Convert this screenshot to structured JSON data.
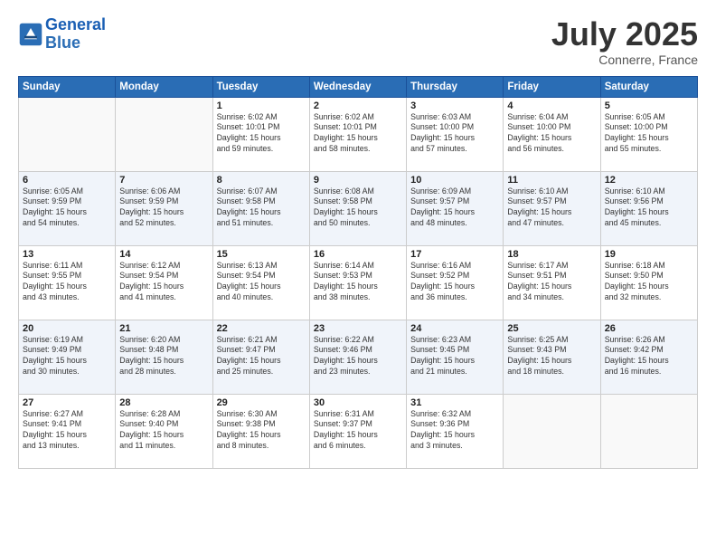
{
  "header": {
    "logo_line1": "General",
    "logo_line2": "Blue",
    "month": "July 2025",
    "location": "Connerre, France"
  },
  "days_of_week": [
    "Sunday",
    "Monday",
    "Tuesday",
    "Wednesday",
    "Thursday",
    "Friday",
    "Saturday"
  ],
  "weeks": [
    [
      {
        "day": "",
        "info": ""
      },
      {
        "day": "",
        "info": ""
      },
      {
        "day": "1",
        "info": "Sunrise: 6:02 AM\nSunset: 10:01 PM\nDaylight: 15 hours\nand 59 minutes."
      },
      {
        "day": "2",
        "info": "Sunrise: 6:02 AM\nSunset: 10:01 PM\nDaylight: 15 hours\nand 58 minutes."
      },
      {
        "day": "3",
        "info": "Sunrise: 6:03 AM\nSunset: 10:00 PM\nDaylight: 15 hours\nand 57 minutes."
      },
      {
        "day": "4",
        "info": "Sunrise: 6:04 AM\nSunset: 10:00 PM\nDaylight: 15 hours\nand 56 minutes."
      },
      {
        "day": "5",
        "info": "Sunrise: 6:05 AM\nSunset: 10:00 PM\nDaylight: 15 hours\nand 55 minutes."
      }
    ],
    [
      {
        "day": "6",
        "info": "Sunrise: 6:05 AM\nSunset: 9:59 PM\nDaylight: 15 hours\nand 54 minutes."
      },
      {
        "day": "7",
        "info": "Sunrise: 6:06 AM\nSunset: 9:59 PM\nDaylight: 15 hours\nand 52 minutes."
      },
      {
        "day": "8",
        "info": "Sunrise: 6:07 AM\nSunset: 9:58 PM\nDaylight: 15 hours\nand 51 minutes."
      },
      {
        "day": "9",
        "info": "Sunrise: 6:08 AM\nSunset: 9:58 PM\nDaylight: 15 hours\nand 50 minutes."
      },
      {
        "day": "10",
        "info": "Sunrise: 6:09 AM\nSunset: 9:57 PM\nDaylight: 15 hours\nand 48 minutes."
      },
      {
        "day": "11",
        "info": "Sunrise: 6:10 AM\nSunset: 9:57 PM\nDaylight: 15 hours\nand 47 minutes."
      },
      {
        "day": "12",
        "info": "Sunrise: 6:10 AM\nSunset: 9:56 PM\nDaylight: 15 hours\nand 45 minutes."
      }
    ],
    [
      {
        "day": "13",
        "info": "Sunrise: 6:11 AM\nSunset: 9:55 PM\nDaylight: 15 hours\nand 43 minutes."
      },
      {
        "day": "14",
        "info": "Sunrise: 6:12 AM\nSunset: 9:54 PM\nDaylight: 15 hours\nand 41 minutes."
      },
      {
        "day": "15",
        "info": "Sunrise: 6:13 AM\nSunset: 9:54 PM\nDaylight: 15 hours\nand 40 minutes."
      },
      {
        "day": "16",
        "info": "Sunrise: 6:14 AM\nSunset: 9:53 PM\nDaylight: 15 hours\nand 38 minutes."
      },
      {
        "day": "17",
        "info": "Sunrise: 6:16 AM\nSunset: 9:52 PM\nDaylight: 15 hours\nand 36 minutes."
      },
      {
        "day": "18",
        "info": "Sunrise: 6:17 AM\nSunset: 9:51 PM\nDaylight: 15 hours\nand 34 minutes."
      },
      {
        "day": "19",
        "info": "Sunrise: 6:18 AM\nSunset: 9:50 PM\nDaylight: 15 hours\nand 32 minutes."
      }
    ],
    [
      {
        "day": "20",
        "info": "Sunrise: 6:19 AM\nSunset: 9:49 PM\nDaylight: 15 hours\nand 30 minutes."
      },
      {
        "day": "21",
        "info": "Sunrise: 6:20 AM\nSunset: 9:48 PM\nDaylight: 15 hours\nand 28 minutes."
      },
      {
        "day": "22",
        "info": "Sunrise: 6:21 AM\nSunset: 9:47 PM\nDaylight: 15 hours\nand 25 minutes."
      },
      {
        "day": "23",
        "info": "Sunrise: 6:22 AM\nSunset: 9:46 PM\nDaylight: 15 hours\nand 23 minutes."
      },
      {
        "day": "24",
        "info": "Sunrise: 6:23 AM\nSunset: 9:45 PM\nDaylight: 15 hours\nand 21 minutes."
      },
      {
        "day": "25",
        "info": "Sunrise: 6:25 AM\nSunset: 9:43 PM\nDaylight: 15 hours\nand 18 minutes."
      },
      {
        "day": "26",
        "info": "Sunrise: 6:26 AM\nSunset: 9:42 PM\nDaylight: 15 hours\nand 16 minutes."
      }
    ],
    [
      {
        "day": "27",
        "info": "Sunrise: 6:27 AM\nSunset: 9:41 PM\nDaylight: 15 hours\nand 13 minutes."
      },
      {
        "day": "28",
        "info": "Sunrise: 6:28 AM\nSunset: 9:40 PM\nDaylight: 15 hours\nand 11 minutes."
      },
      {
        "day": "29",
        "info": "Sunrise: 6:30 AM\nSunset: 9:38 PM\nDaylight: 15 hours\nand 8 minutes."
      },
      {
        "day": "30",
        "info": "Sunrise: 6:31 AM\nSunset: 9:37 PM\nDaylight: 15 hours\nand 6 minutes."
      },
      {
        "day": "31",
        "info": "Sunrise: 6:32 AM\nSunset: 9:36 PM\nDaylight: 15 hours\nand 3 minutes."
      },
      {
        "day": "",
        "info": ""
      },
      {
        "day": "",
        "info": ""
      }
    ]
  ]
}
